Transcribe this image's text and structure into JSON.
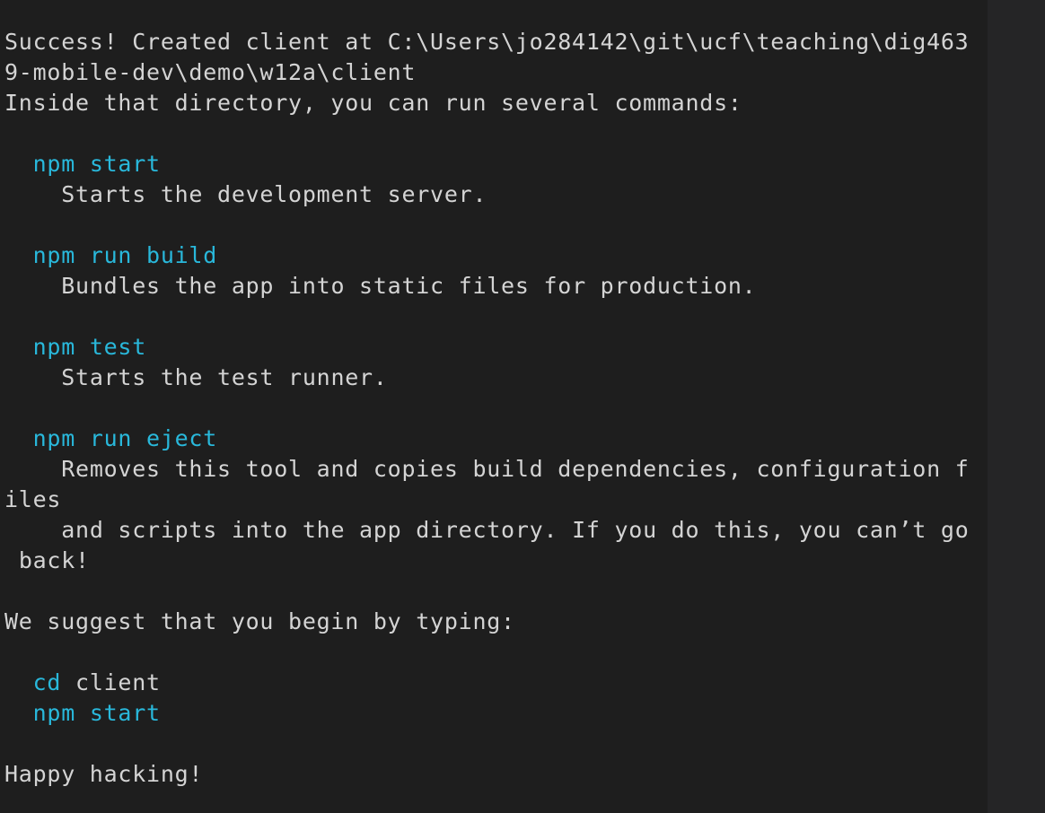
{
  "terminal": {
    "lines": [
      {
        "indent": "",
        "text": "Success! Created client at C:\\Users\\jo284142\\git\\ucf\\teaching\\dig463"
      },
      {
        "indent": "",
        "text": "9-mobile-dev\\demo\\w12a\\client"
      },
      {
        "indent": "",
        "text": "Inside that directory, you can run several commands:"
      },
      {
        "indent": "",
        "text": ""
      },
      {
        "indent": "  ",
        "command": "npm start"
      },
      {
        "indent": "    ",
        "text": "Starts the development server."
      },
      {
        "indent": "",
        "text": ""
      },
      {
        "indent": "  ",
        "command": "npm run build"
      },
      {
        "indent": "    ",
        "text": "Bundles the app into static files for production."
      },
      {
        "indent": "",
        "text": ""
      },
      {
        "indent": "  ",
        "command": "npm test"
      },
      {
        "indent": "    ",
        "text": "Starts the test runner."
      },
      {
        "indent": "",
        "text": ""
      },
      {
        "indent": "  ",
        "command": "npm run eject"
      },
      {
        "indent": "    ",
        "text": "Removes this tool and copies build dependencies, configuration f"
      },
      {
        "indent": "",
        "text": "iles"
      },
      {
        "indent": "    ",
        "text": "and scripts into the app directory. If you do this, you can’t go"
      },
      {
        "indent": " ",
        "text": "back!"
      },
      {
        "indent": "",
        "text": ""
      },
      {
        "indent": "",
        "text": "We suggest that you begin by typing:"
      },
      {
        "indent": "",
        "text": ""
      },
      {
        "indent": "  ",
        "command": "cd",
        "args": " client"
      },
      {
        "indent": "  ",
        "command": "npm start"
      },
      {
        "indent": "",
        "text": ""
      },
      {
        "indent": "",
        "text": "Happy hacking!"
      }
    ]
  },
  "colors": {
    "background": "#1e1e1e",
    "text": "#d4d4d4",
    "command": "#29b8db",
    "gutter": "#252526"
  }
}
